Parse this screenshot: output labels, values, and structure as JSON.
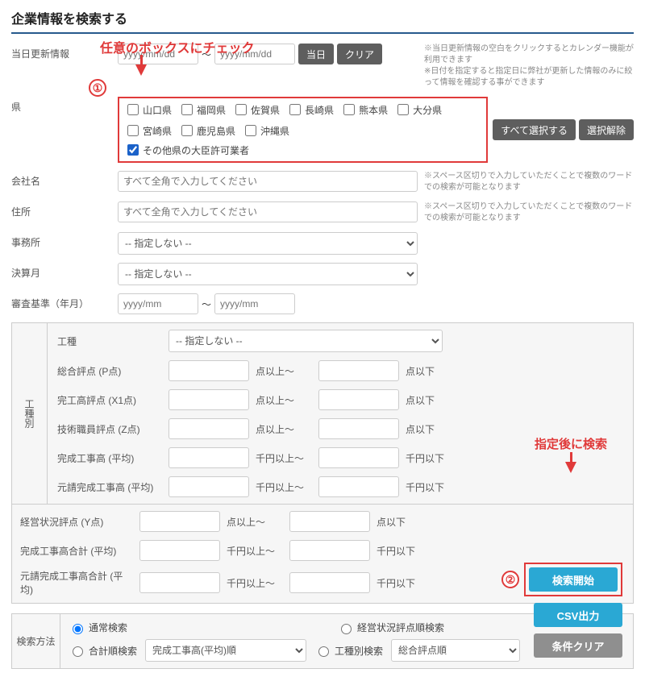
{
  "title": "企業情報を検索する",
  "anno1": "任意のボックスにチェック",
  "anno2": "指定後に検索",
  "circle1": "①",
  "circle2": "②",
  "update": {
    "label": "当日更新情報",
    "from_ph": "yyyy/mm/dd",
    "to_ph": "yyyy/mm/dd",
    "tilde": "～",
    "btn_today": "当日",
    "btn_clear2": "クリア",
    "note": "※当日更新情報の空白をクリックするとカレンダー機能が利用できます\n※日付を指定すると指定日に弊社が更新した情報のみに絞って情報を確認する事ができます"
  },
  "pref": {
    "label": "県",
    "items": [
      "山口県",
      "福岡県",
      "佐賀県",
      "長崎県",
      "熊本県",
      "大分県",
      "宮崎県",
      "鹿児島県",
      "沖縄県"
    ],
    "extra": "その他県の大臣許可業者",
    "btn_all": "すべて選択する",
    "btn_none": "選択解除"
  },
  "company": {
    "label": "会社名",
    "ph": "すべて全角で入力してください",
    "note": "※スペース区切りで入力していただくことで複数のワードでの検索が可能となります"
  },
  "address": {
    "label": "住所",
    "ph": "すべて全角で入力してください",
    "note": "※スペース区切りで入力していただくことで複数のワードでの検索が可能となります"
  },
  "office": {
    "label": "事務所",
    "opt": "-- 指定しない --"
  },
  "fymonth": {
    "label": "決算月",
    "opt": "-- 指定しない --"
  },
  "audit": {
    "label": "審査基準（年月）",
    "ph": "yyyy/mm",
    "tilde": "～"
  },
  "ktype": {
    "side": "工種別",
    "type_label": "工種",
    "type_opt": "-- 指定しない --",
    "rows": [
      {
        "label": "総合評点 (P点)",
        "u1": "点以上～",
        "u2": "点以下"
      },
      {
        "label": "完工高評点 (X1点)",
        "u1": "点以上～",
        "u2": "点以下"
      },
      {
        "label": "技術職員評点 (Z点)",
        "u1": "点以上～",
        "u2": "点以下"
      },
      {
        "label": "完成工事高 (平均)",
        "u1": "千円以上～",
        "u2": "千円以下"
      },
      {
        "label": "元請完成工事高 (平均)",
        "u1": "千円以上～",
        "u2": "千円以下"
      }
    ]
  },
  "extra_rows": [
    {
      "label": "経営状況評点 (Y点)",
      "u1": "点以上～",
      "u2": "点以下"
    },
    {
      "label": "完成工事高合計 (平均)",
      "u1": "千円以上～",
      "u2": "千円以下"
    },
    {
      "label": "元請完成工事高合計 (平均)",
      "u1": "千円以上～",
      "u2": "千円以下"
    }
  ],
  "searchmethod": {
    "label": "検索方法",
    "r1": "通常検索",
    "r2": "経営状況評点順検索",
    "r3": "合計順検索",
    "sel3": "完成工事高(平均)順",
    "r4": "工種別検索",
    "sel4": "総合評点順"
  },
  "actions": {
    "search": "検索開始",
    "csv": "CSV出力",
    "clear": "条件クリア"
  }
}
